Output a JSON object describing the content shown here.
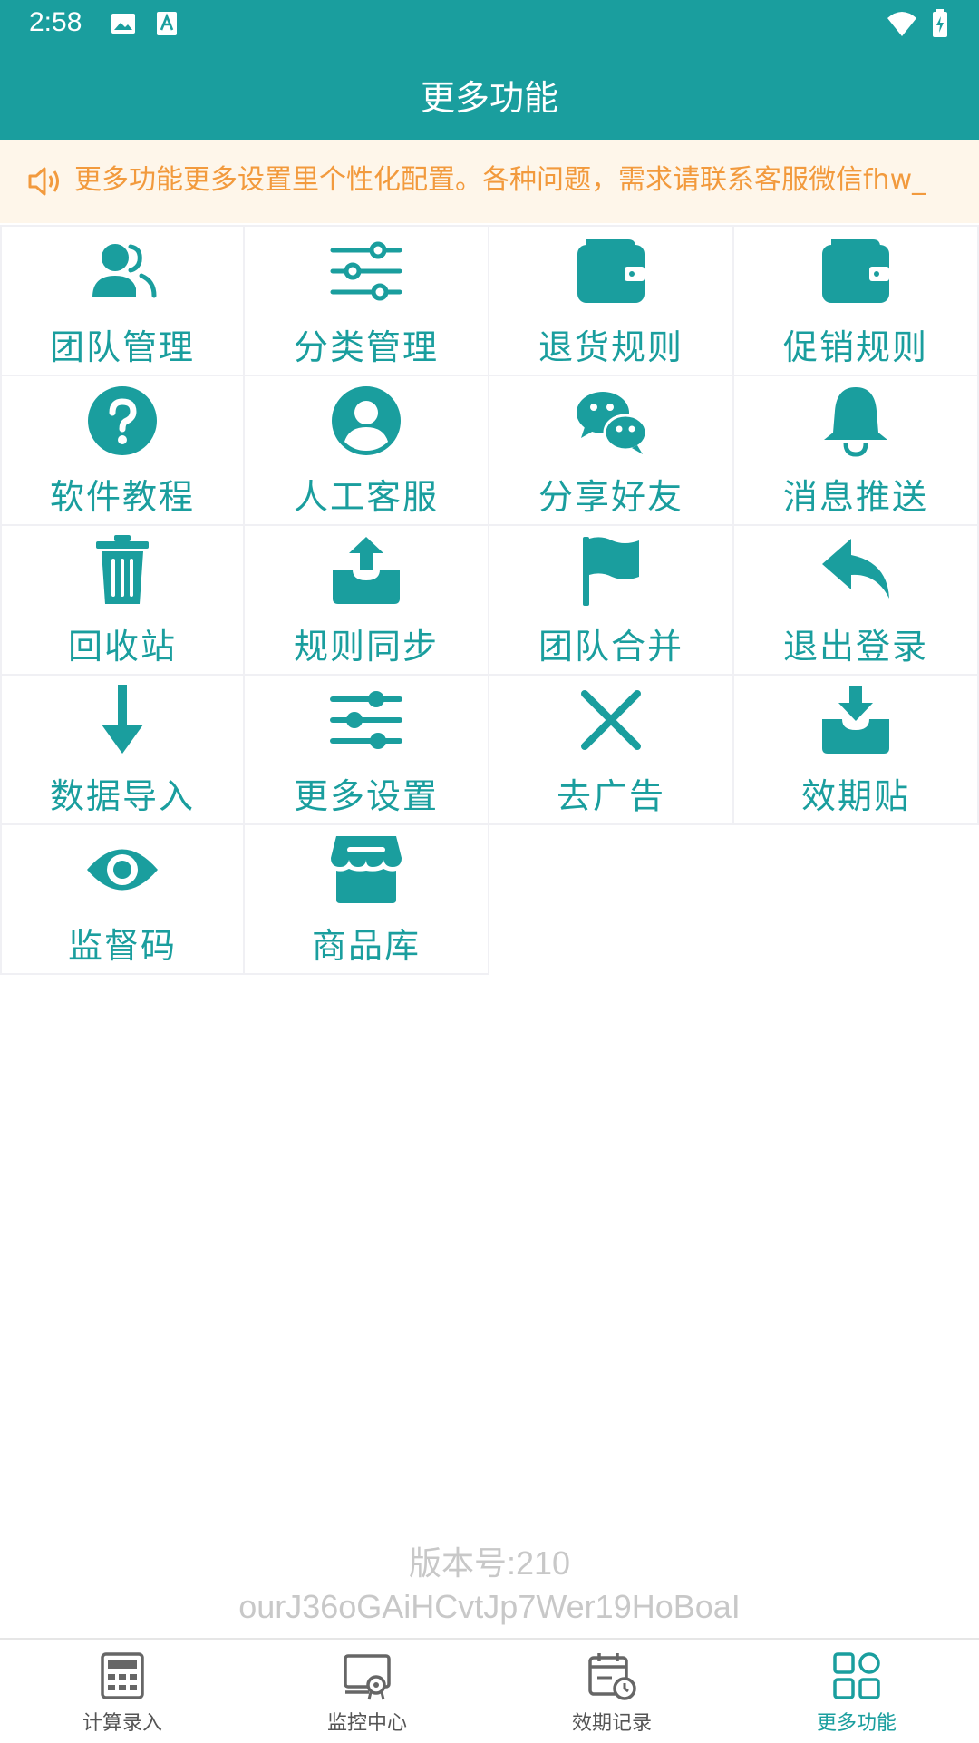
{
  "status_bar": {
    "time": "2:58"
  },
  "app_bar": {
    "title": "更多功能"
  },
  "notice": {
    "text": "更多功能更多设置里个性化配置。各种问题，需求请联系客服微信fhw_"
  },
  "colors": {
    "accent": "#1a9e9e",
    "notice_text": "#f29a3d",
    "notice_bg": "#fef6ea"
  },
  "grid": {
    "items": [
      {
        "label": "团队管理",
        "icon": "team-icon"
      },
      {
        "label": "分类管理",
        "icon": "sliders-icon"
      },
      {
        "label": "退货规则",
        "icon": "wallet-icon"
      },
      {
        "label": "促销规则",
        "icon": "wallet-icon"
      },
      {
        "label": "软件教程",
        "icon": "help-icon"
      },
      {
        "label": "人工客服",
        "icon": "user-circle-icon"
      },
      {
        "label": "分享好友",
        "icon": "wechat-icon"
      },
      {
        "label": "消息推送",
        "icon": "bell-icon"
      },
      {
        "label": "回收站",
        "icon": "trash-icon"
      },
      {
        "label": "规则同步",
        "icon": "upload-tray-icon"
      },
      {
        "label": "团队合并",
        "icon": "flag-icon"
      },
      {
        "label": "退出登录",
        "icon": "reply-icon"
      },
      {
        "label": "数据导入",
        "icon": "arrow-down-icon"
      },
      {
        "label": "更多设置",
        "icon": "sliders-icon"
      },
      {
        "label": "去广告",
        "icon": "close-icon"
      },
      {
        "label": "效期贴",
        "icon": "download-tray-icon"
      },
      {
        "label": "监督码",
        "icon": "eye-icon"
      },
      {
        "label": "商品库",
        "icon": "store-icon"
      }
    ]
  },
  "version": {
    "line1": "版本号:210",
    "line2": "ourJ36oGAiHCvtJp7Wer19HoBoaI"
  },
  "bottom_nav": {
    "items": [
      {
        "label": "计算录入",
        "icon": "calculator-icon",
        "active": false
      },
      {
        "label": "监控中心",
        "icon": "monitor-icon",
        "active": false
      },
      {
        "label": "效期记录",
        "icon": "calendar-clock-icon",
        "active": false
      },
      {
        "label": "更多功能",
        "icon": "grid-icon",
        "active": true
      }
    ]
  }
}
